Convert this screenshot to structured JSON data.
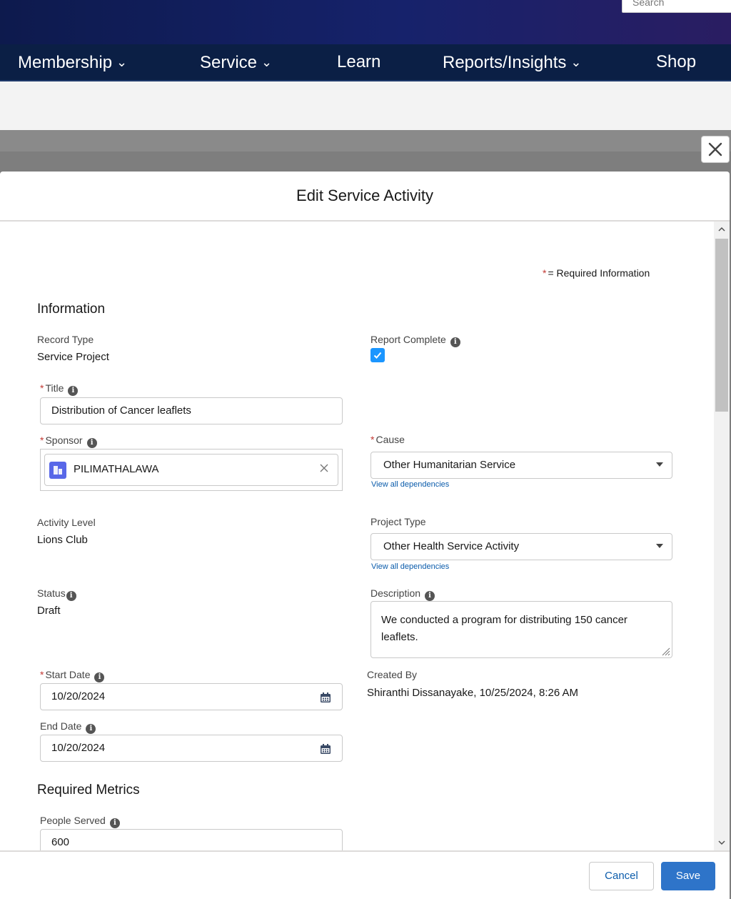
{
  "header": {
    "search_placeholder": "Search"
  },
  "nav": {
    "items": [
      {
        "label": "Membership",
        "has_dropdown": true
      },
      {
        "label": "Service",
        "has_dropdown": true
      },
      {
        "label": "Learn",
        "has_dropdown": false
      },
      {
        "label": "Reports/Insights",
        "has_dropdown": true
      },
      {
        "label": "Shop",
        "has_dropdown": false
      }
    ],
    "chevron": "⌄"
  },
  "modal": {
    "title": "Edit Service Activity",
    "required_legend_star": "*",
    "required_legend": "= Required Information",
    "info_section_title": "Information",
    "record_type": {
      "label": "Record Type",
      "value": "Service Project"
    },
    "report_complete": {
      "label": "Report Complete",
      "checked": true
    },
    "title_field": {
      "label": "Title",
      "value": "Distribution of Cancer leaflets",
      "required": true
    },
    "sponsor": {
      "label": "Sponsor",
      "value": "PILIMATHALAWA",
      "required": true
    },
    "cause": {
      "label": "Cause",
      "value": "Other Humanitarian Service",
      "required": true,
      "link": "View all dependencies"
    },
    "activity_level": {
      "label": "Activity Level",
      "value": "Lions Club"
    },
    "project_type": {
      "label": "Project Type",
      "value": "Other Health Service Activity",
      "link": "View all dependencies"
    },
    "status": {
      "label": "Status",
      "value": "Draft"
    },
    "description": {
      "label": "Description",
      "value": "We conducted a program for distributing 150 cancer leaflets."
    },
    "start_date": {
      "label": "Start Date",
      "value": "10/20/2024",
      "required": true
    },
    "created_by": {
      "label": "Created By",
      "value": "Shiranthi Dissanayake, 10/25/2024, 8:26 AM"
    },
    "end_date": {
      "label": "End Date",
      "value": "10/20/2024"
    },
    "metrics_section_title": "Required Metrics",
    "people_served": {
      "label": "People Served",
      "value": "600"
    }
  },
  "footer": {
    "cancel_label": "Cancel",
    "save_label": "Save"
  },
  "colors": {
    "nav_bg": "#0b1f45",
    "primary": "#2e74c9",
    "required": "#c23934",
    "link": "#0b5cab",
    "checkbox": "#1b96ff"
  }
}
